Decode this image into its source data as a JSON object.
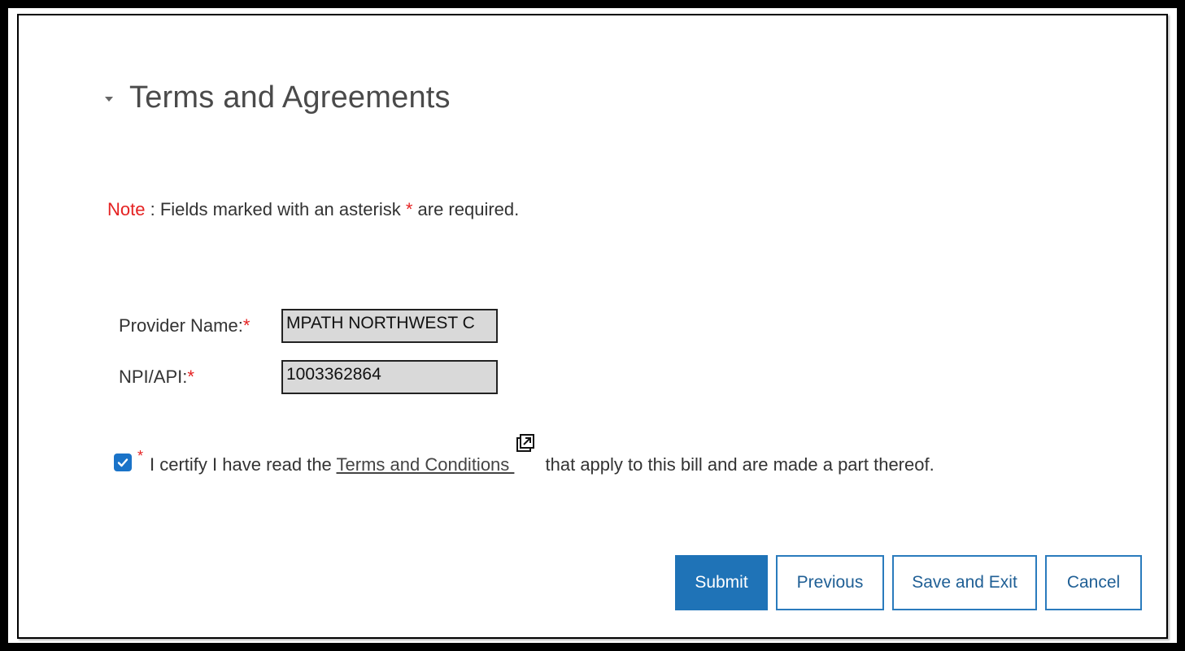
{
  "section": {
    "title": "Terms and Agreements"
  },
  "note": {
    "label": "Note",
    "text_before": " : Fields marked with an asterisk ",
    "asterisk": "*",
    "text_after": " are required."
  },
  "fields": {
    "provider_name": {
      "label": "Provider Name:",
      "required_mark": "*",
      "value": "MPATH NORTHWEST C"
    },
    "npi_api": {
      "label": "NPI/API:",
      "required_mark": "*",
      "value": "1003362864"
    }
  },
  "certify": {
    "checked": true,
    "required_mark": "*",
    "text_before": "I certify I have read the ",
    "link_text": "Terms and Conditions ",
    "text_after": " that apply to this bill and are made a part thereof."
  },
  "buttons": {
    "submit": "Submit",
    "previous": "Previous",
    "save_and_exit": "Save and Exit",
    "cancel": "Cancel"
  },
  "colors": {
    "required": "#e52222",
    "primary_button": "#1f73b7",
    "checkbox": "#1a73c8"
  },
  "icons": {
    "collapse": "caret-down-icon",
    "external_link": "external-link-icon",
    "checkbox": "checkmark-icon"
  }
}
